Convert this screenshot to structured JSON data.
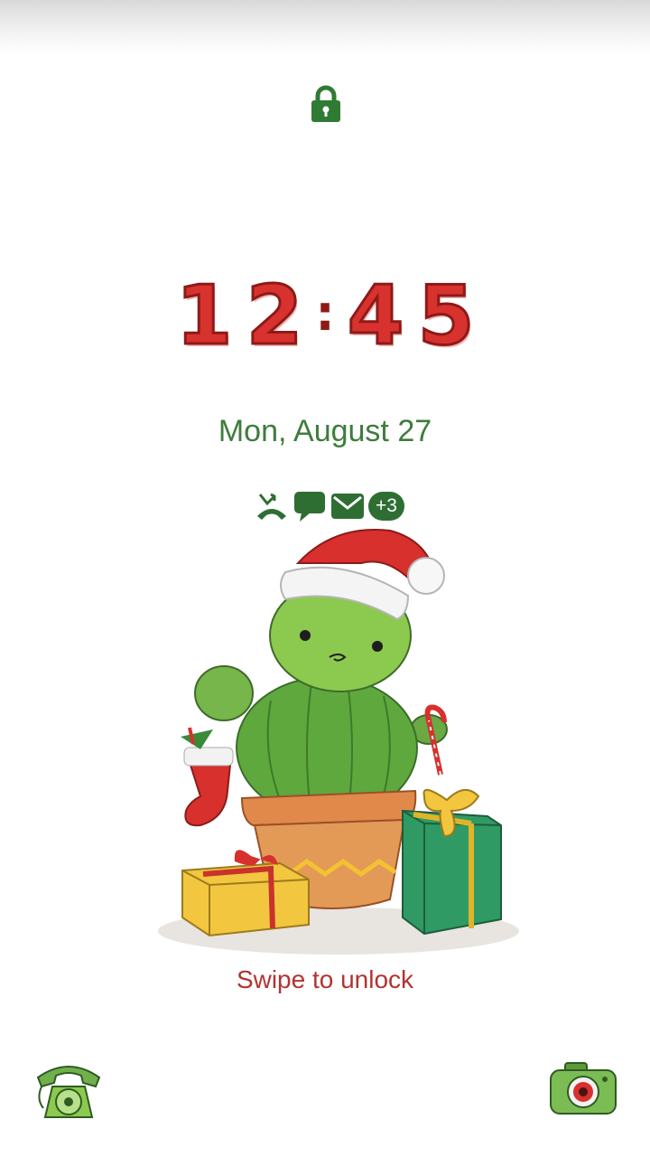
{
  "lockscreen": {
    "lock_icon": "padlock-icon",
    "clock": {
      "h1": "1",
      "h2": "2",
      "separator": ":",
      "m1": "4",
      "m2": "5"
    },
    "date": "Mon, August 27",
    "notifications": {
      "icons": [
        "missed-call-icon",
        "message-icon",
        "email-icon"
      ],
      "more_count": "+3"
    },
    "swipe_hint": "Swipe to unlock",
    "shortcuts": {
      "left": "phone-icon",
      "right": "camera-icon"
    }
  },
  "colors": {
    "accent_green": "#3d7d3b",
    "dark_green": "#2f6e33",
    "clock_red": "#d8322e",
    "swipe_red": "#b23332"
  }
}
